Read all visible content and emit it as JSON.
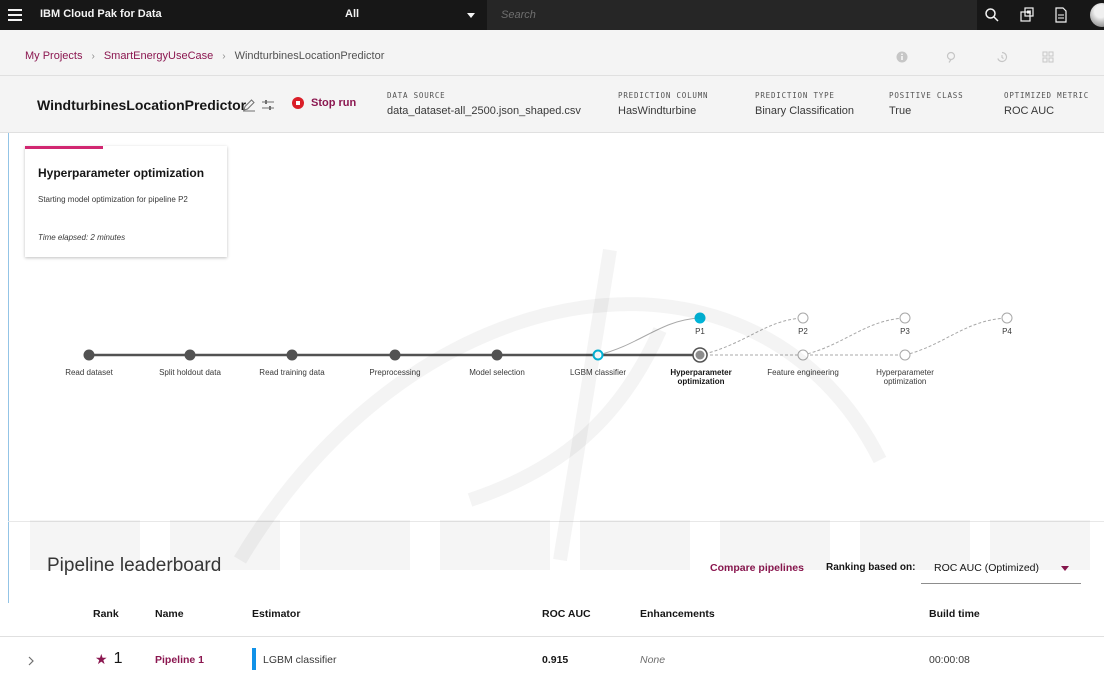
{
  "topnav": {
    "brand": "IBM Cloud Pak for Data",
    "scope": "All",
    "search_placeholder": "Search"
  },
  "breadcrumb": {
    "items": [
      "My Projects",
      "SmartEnergyUseCase"
    ],
    "current": "WindturbinesLocationPredictor"
  },
  "experiment": {
    "title": "WindturbinesLocationPredictor",
    "stop_label": "Stop run",
    "meta": [
      {
        "label": "DATA SOURCE",
        "value": "data_dataset-all_2500.json_shaped.csv"
      },
      {
        "label": "PREDICTION COLUMN",
        "value": "HasWindturbine"
      },
      {
        "label": "PREDICTION TYPE",
        "value": "Binary Classification"
      },
      {
        "label": "POSITIVE CLASS",
        "value": "True"
      },
      {
        "label": "OPTIMIZED METRIC",
        "value": "ROC AUC"
      }
    ]
  },
  "status_card": {
    "title": "Hyperparameter optimization",
    "description": "Starting model optimization for pipeline P2",
    "elapsed": "Time elapsed: 2 minutes"
  },
  "pipeline_steps": [
    "Read dataset",
    "Split holdout data",
    "Read training data",
    "Preprocessing",
    "Model selection",
    "LGBM classifier",
    "Hyperparameter optimization",
    "Feature engineering",
    "Hyperparameter optimization"
  ],
  "pipeline_nodes": [
    "P1",
    "P2",
    "P3",
    "P4"
  ],
  "leaderboard": {
    "title": "Pipeline leaderboard",
    "compare_label": "Compare pipelines",
    "ranking_label": "Ranking based on:",
    "ranking_value": "ROC AUC (Optimized)",
    "columns": {
      "rank": "Rank",
      "name": "Name",
      "estimator": "Estimator",
      "metric": "ROC AUC",
      "enhancements": "Enhancements",
      "build_time": "Build time"
    },
    "rows": [
      {
        "rank": "1",
        "name": "Pipeline 1",
        "estimator": "LGBM classifier",
        "roc_auc": "0.915",
        "enhancements": "None",
        "build_time": "00:00:08"
      }
    ]
  },
  "colors": {
    "brand_accent": "#8b1750",
    "stop": "#da1e28",
    "progress": "#1192e8",
    "active_node": "#00b4d8"
  }
}
